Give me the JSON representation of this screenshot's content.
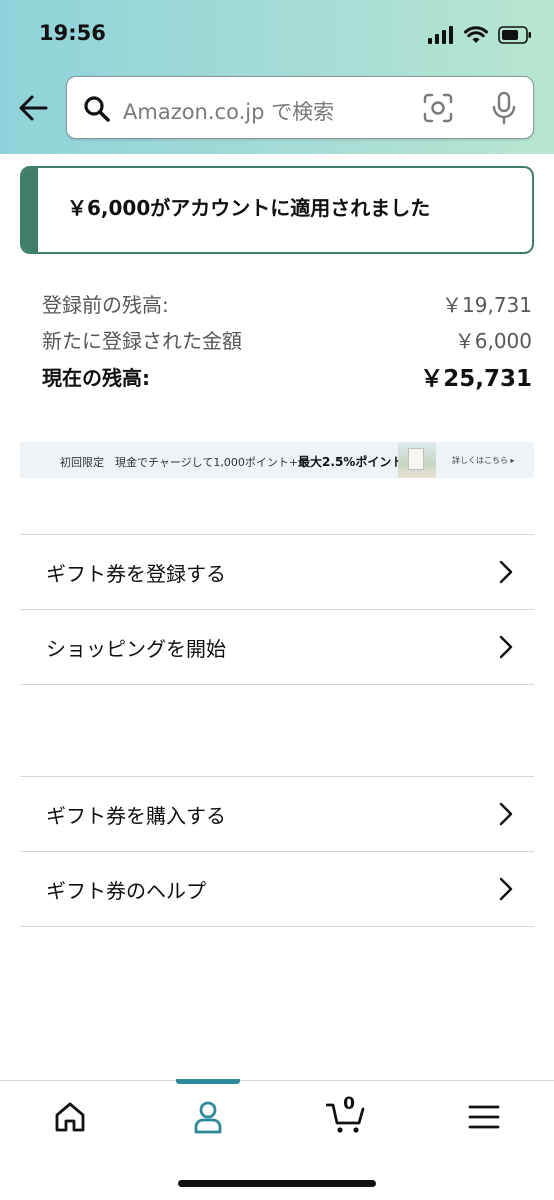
{
  "status_bar": {
    "time": "19:56"
  },
  "header": {
    "back_icon": "arrow-left-icon",
    "search": {
      "placeholder": "Amazon.co.jp で検索"
    }
  },
  "alert": {
    "message": "￥6,000がアカウントに適用されました",
    "accent_color": "#3f7f68"
  },
  "balance": {
    "rows": [
      {
        "label": "登録前の残高:",
        "value": "￥19,731"
      },
      {
        "label": "新たに登録された金額",
        "value": "￥6,000"
      },
      {
        "label": "現在の残高:",
        "value": "￥25,731"
      }
    ]
  },
  "banner": {
    "prefix": "初回限定　現金でチャージして1,000ポイント+",
    "highlight": "最大2.5%ポイント",
    "link": "詳しくはこちら ▸"
  },
  "menu_group_1": [
    {
      "label": "ギフト券を登録する"
    },
    {
      "label": "ショッピングを開始"
    }
  ],
  "menu_group_2": [
    {
      "label": "ギフト券を購入する"
    },
    {
      "label": "ギフト券のヘルプ"
    }
  ],
  "bottom_nav": {
    "items": [
      "home-icon",
      "account-icon",
      "cart-icon",
      "menu-icon"
    ],
    "active": "account-icon",
    "cart_count": "0",
    "accent_color": "#2a8a9a"
  }
}
